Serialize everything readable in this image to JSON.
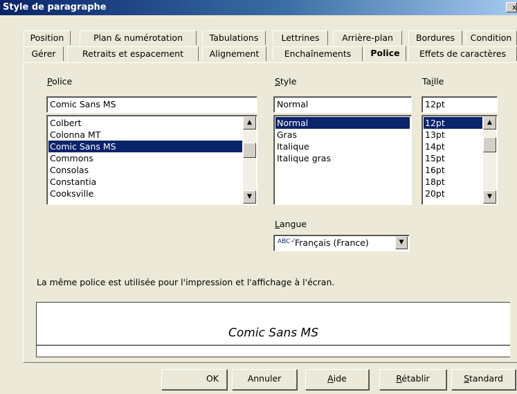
{
  "window": {
    "title": "Style de paragraphe",
    "close_glyph": "x"
  },
  "tabs_row1": [
    "Position",
    "Plan & numérotation",
    "Tabulations",
    "Lettrines",
    "Arrière-plan",
    "Bordures",
    "Condition"
  ],
  "tabs_row2": [
    "Gérer",
    "Retraits et espacement",
    "Alignement",
    "Enchaînements",
    "Police",
    "Effets de caractères"
  ],
  "active_tab": "Police",
  "font": {
    "label": "Police",
    "value": "Comic Sans MS",
    "items": [
      "Colbert",
      "Colonna MT",
      "Comic Sans MS",
      "Commons",
      "Consolas",
      "Constantia",
      "Cooksville"
    ],
    "selected": "Comic Sans MS"
  },
  "style": {
    "label": "Style",
    "value": "Normal",
    "items": [
      "Normal",
      "Gras",
      "Italique",
      "Italique gras"
    ],
    "selected": "Normal"
  },
  "size": {
    "label": "Taille",
    "value": "12pt",
    "items": [
      "12pt",
      "13pt",
      "14pt",
      "15pt",
      "16pt",
      "18pt",
      "20pt"
    ],
    "selected": "12pt"
  },
  "language": {
    "label": "Langue",
    "value": "Français (France)",
    "icon": "spellcheck-icon",
    "icon_text": "ABC"
  },
  "info_text": "La même police est utilisée pour l'impression et l'affichage à l'écran.",
  "preview": {
    "text": "Comic Sans MS"
  },
  "buttons": {
    "ok": "OK",
    "cancel": "Annuler",
    "help": "Aide",
    "reset": "Rétablir",
    "standard": "Standard"
  },
  "colors": {
    "selection": "#0a246a",
    "face": "#ece9d8",
    "title_start": "#0a246a"
  }
}
